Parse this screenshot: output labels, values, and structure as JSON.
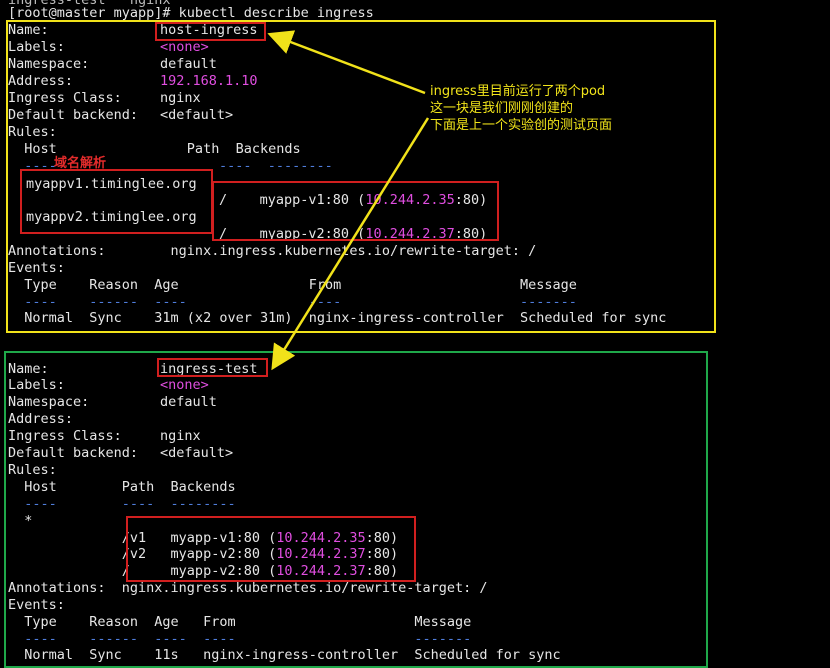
{
  "top": {
    "partial_line": "ingress-test   nginx",
    "prompt": "[root@master myapp]# kubectl describe ingress"
  },
  "ing1": {
    "name_label": "Name:",
    "name": "host-ingress",
    "labels_label": "Labels:",
    "labels": "<none>",
    "ns_label": "Namespace:",
    "ns": "default",
    "addr_label": "Address:",
    "addr": "192.168.1.10",
    "class_label": "Ingress Class:",
    "class": "nginx",
    "backend_label": "Default backend:",
    "backend": "<default>",
    "rules_label": "Rules:",
    "rules_header": "  Host                Path  Backends",
    "rules_sep_a": "  ----",
    "rules_sep_b": "----  --------",
    "host1": "myappv1.timinglee.org",
    "host2": "myappv2.timinglee.org",
    "path1_pre": "/    myapp-v1:80 (",
    "path1_ip": "10.244.2.35",
    "path1_post": ":80)",
    "path2_pre": "/    myapp-v2:80 (",
    "path2_ip": "10.244.2.37",
    "path2_post": ":80)",
    "annotations": "Annotations:        nginx.ingress.kubernetes.io/rewrite-target: /",
    "events_label": "Events:",
    "ev_header": "  Type    Reason  Age                From                      Message",
    "ev_sep": "  ----    ------  ----               ----                      -------",
    "ev_row": "  Normal  Sync    31m (x2 over 31m)  nginx-ingress-controller  Scheduled for sync"
  },
  "ing2": {
    "name_label": "Name:",
    "name": "ingress-test",
    "labels_label": "Labels:",
    "labels": "<none>",
    "ns_label": "Namespace:",
    "ns": "default",
    "addr_label": "Address:",
    "class_label": "Ingress Class:",
    "class": "nginx",
    "backend_label": "Default backend:",
    "backend": "<default>",
    "rules_label": "Rules:",
    "rules_header": "  Host        Path  Backends",
    "rules_sep": "  ----        ----  --------",
    "host_star": "  *",
    "p1_pre": "              /v1   myapp-v1:80 (",
    "p1_ip": "10.244.2.35",
    "p1_post": ":80)",
    "p2_pre": "              /v2   myapp-v2:80 (",
    "p2_ip": "10.244.2.37",
    "p2_post": ":80)",
    "p3_pre": "              /     myapp-v2:80 (",
    "p3_ip": "10.244.2.37",
    "p3_post": ":80)",
    "annotations": "Annotations:  nginx.ingress.kubernetes.io/rewrite-target: /",
    "events_label": "Events:",
    "ev_header": "  Type    Reason  Age   From                      Message",
    "ev_sep": "  ----    ------  ----  ----                      -------",
    "ev_row": "  Normal  Sync    11s   nginx-ingress-controller  Scheduled for sync"
  },
  "notes": {
    "yellow_1": "ingress里目前运行了两个pod",
    "yellow_2": "这一块是我们刚刚创建的",
    "yellow_3": "下面是上一个实验创的测试页面",
    "red_dns": "域名解析"
  },
  "colors": {
    "yellow": "#f1e21a",
    "green": "#1fa84a",
    "red": "#d11f1f",
    "magenta": "#e04ee0"
  }
}
